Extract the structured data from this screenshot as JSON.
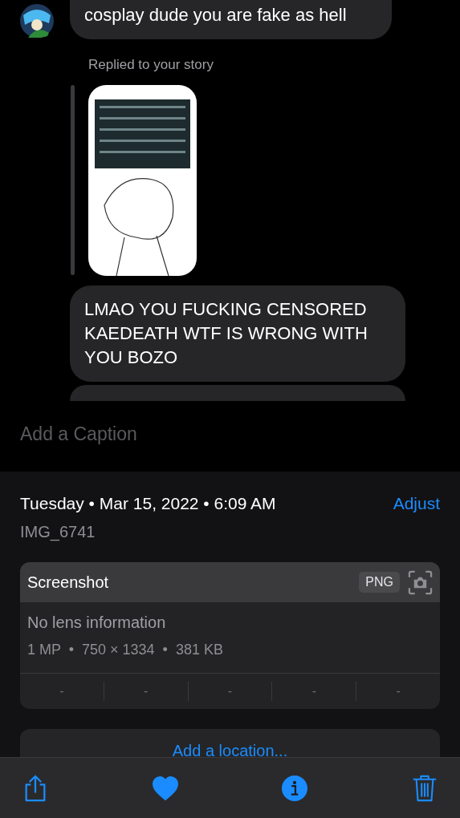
{
  "chat": {
    "messages": [
      {
        "kind": "text",
        "text": "cosplay dude you are fake as hell",
        "avatar": true
      },
      {
        "kind": "story-reply",
        "label": "Replied to your story"
      },
      {
        "kind": "text",
        "text": "LMAO YOU FUCKING CENSORED KAEDEATH WTF IS WRONG WITH YOU BOZO",
        "avatar": false
      },
      {
        "kind": "cut",
        "avatar": false
      }
    ]
  },
  "caption": {
    "placeholder": "Add a Caption"
  },
  "info": {
    "date": "Tuesday • Mar 15, 2022 • 6:09 AM",
    "adjust": "Adjust",
    "filename": "IMG_6741",
    "card": {
      "title": "Screenshot",
      "format": "PNG",
      "lens": "No lens information",
      "specs": "1 MP  •  750 × 1334  •  381 KB",
      "exif": [
        "-",
        "-",
        "-",
        "-",
        "-"
      ]
    },
    "location": "Add a location..."
  },
  "toolbar": [
    {
      "kind": "share",
      "selected": false
    },
    {
      "kind": "favorite",
      "selected": true
    },
    {
      "kind": "info",
      "selected": true
    },
    {
      "kind": "delete",
      "selected": false
    }
  ]
}
